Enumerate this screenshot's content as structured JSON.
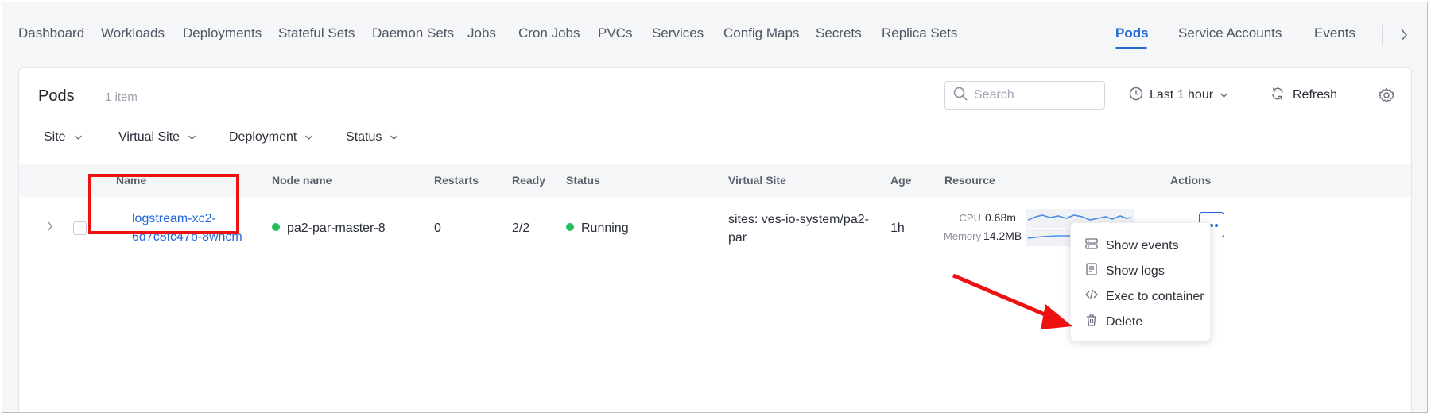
{
  "tabs": [
    {
      "label": "Dashboard"
    },
    {
      "label": "Workloads"
    },
    {
      "label": "Deployments"
    },
    {
      "label": "Stateful Sets"
    },
    {
      "label": "Daemon Sets"
    },
    {
      "label": "Jobs"
    },
    {
      "label": "Cron Jobs"
    },
    {
      "label": "PVCs"
    },
    {
      "label": "Services"
    },
    {
      "label": "Config Maps"
    },
    {
      "label": "Secrets"
    },
    {
      "label": "Replica Sets"
    },
    {
      "label": "Pods"
    },
    {
      "label": "Service Accounts"
    },
    {
      "label": "Events"
    }
  ],
  "active_tab": "Pods",
  "header": {
    "title": "Pods",
    "count": "1 item",
    "search_placeholder": "Search",
    "time_range": "Last 1 hour",
    "refresh_label": "Refresh"
  },
  "filters": [
    "Site",
    "Virtual Site",
    "Deployment",
    "Status"
  ],
  "table": {
    "columns": [
      "Name",
      "Node name",
      "Restarts",
      "Ready",
      "Status",
      "Virtual Site",
      "Age",
      "Resource",
      "Actions"
    ],
    "rows": [
      {
        "name_line1": "logstream-xc2-",
        "name_line2": "6d7c8fc47b-8whcm",
        "node": "pa2-par-master-8",
        "restarts": "0",
        "ready": "2/2",
        "status": "Running",
        "virtual_site_line1": "sites: ves-io-system/pa2-",
        "virtual_site_line2": "par",
        "age": "1h",
        "cpu_label": "CPU",
        "cpu_value": "0.68m",
        "memory_label": "Memory",
        "memory_value": "14.2MB"
      }
    ]
  },
  "menu": {
    "items": [
      {
        "label": "Show events",
        "icon": "events-icon"
      },
      {
        "label": "Show logs",
        "icon": "logs-icon"
      },
      {
        "label": "Exec to container",
        "icon": "code-icon"
      },
      {
        "label": "Delete",
        "icon": "trash-icon"
      }
    ]
  },
  "colors": {
    "accent": "#2468d8",
    "running": "#22c05e",
    "annotation_red": "#ee1111"
  }
}
